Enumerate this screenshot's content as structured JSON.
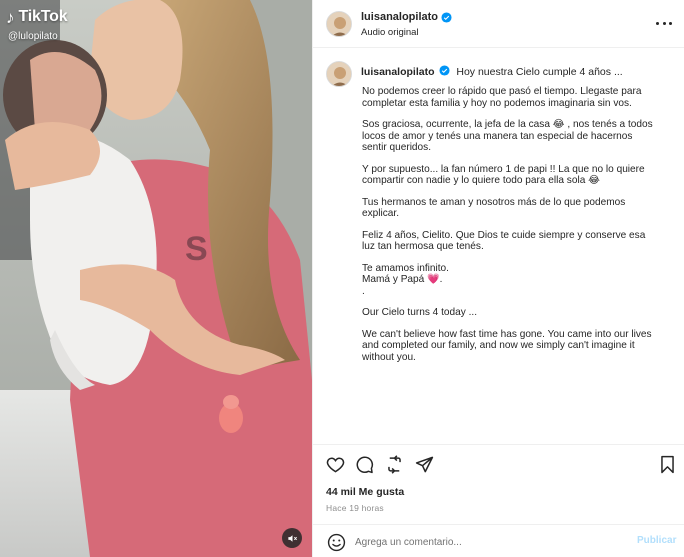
{
  "media": {
    "watermark_brand": "TikTok",
    "watermark_handle": "@lulopilato",
    "sound_icon": "speaker-muted-icon"
  },
  "post": {
    "username": "luisanalopilato",
    "audio_label": "Audio original",
    "more_icon": "more-horizontal-icon",
    "caption_headline": "Hoy nuestra Cielo cumple 4 años ...",
    "caption_paragraphs": [
      "No podemos creer lo rápido que pasó el tiempo. Llegaste para completar esta familia y hoy no podemos imaginaria sin vos.",
      "Sos graciosa, ocurrente, la jefa de la casa 😂 , nos tenés a todos locos de amor y tenés una manera tan especial de hacernos sentir queridos.",
      "Y por supuesto... la fan número 1 de papi !! La que no lo quiere compartir con nadie y lo quiere todo para ella sola 😂",
      "Tus hermanos te aman y nosotros más de lo que podemos explicar.",
      "Feliz 4 años, Cielito. Que Dios te cuide siempre y conserve esa luz tan hermosa que tenés.",
      "Te amamos infinito.\nMamá y Papá 💗.\n.",
      "Our Cielo turns 4 today ...",
      "We can't believe how fast time has gone. You came into our lives and completed our family, and now we simply can't imagine it without you."
    ],
    "likes": "44 mil Me gusta",
    "time_ago": "Hace 19 horas",
    "comment_placeholder": "Agrega un comentario...",
    "publish_label": "Publicar"
  },
  "colors": {
    "verified": "#0095f6",
    "publish_disabled": "#b2dffc",
    "text": "#262626",
    "secondary": "#8e8e8e"
  }
}
